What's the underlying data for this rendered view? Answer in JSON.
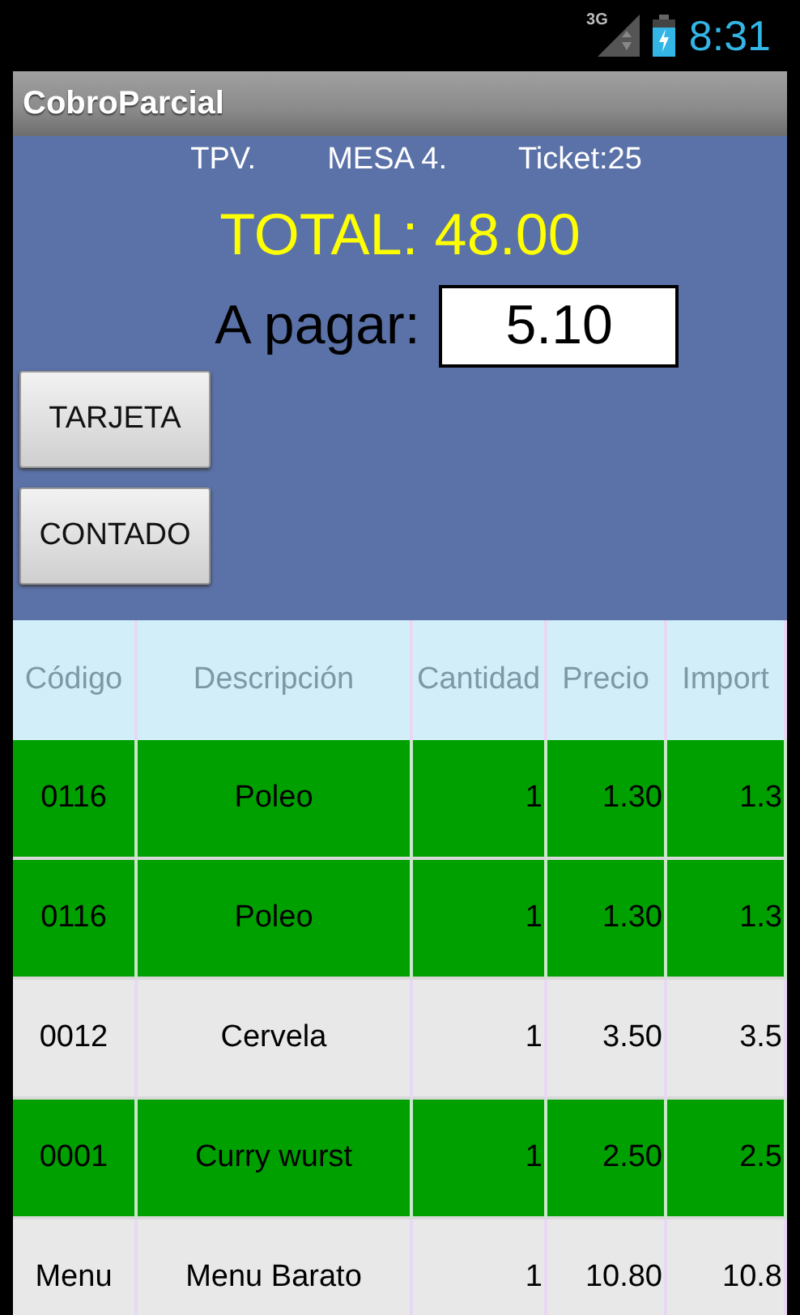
{
  "status_bar": {
    "network": "3G",
    "time": "8:31"
  },
  "title": "CobroParcial",
  "header": {
    "terminal": "TPV.",
    "table": "MESA 4.",
    "ticket": "Ticket:25"
  },
  "total": "TOTAL: 48.00",
  "payment": {
    "label": "A pagar:",
    "value": "5.10"
  },
  "buttons": [
    "TARJETA",
    "CONTADO"
  ],
  "table": {
    "columns": [
      "Código",
      "Descripción",
      "Cantidad",
      "Precio",
      "Import"
    ],
    "rows": [
      {
        "cells": [
          "0116",
          "Poleo",
          "1",
          "1.30",
          "1.3"
        ],
        "selected": true
      },
      {
        "cells": [
          "0116",
          "Poleo",
          "1",
          "1.30",
          "1.3"
        ],
        "selected": true
      },
      {
        "cells": [
          "0012",
          "Cervela",
          "1",
          "3.50",
          "3.5"
        ],
        "selected": false
      },
      {
        "cells": [
          "0001",
          "Curry wurst",
          "1",
          "2.50",
          "2.5"
        ],
        "selected": true
      },
      {
        "cells": [
          "Menu",
          "Menu Barato",
          "1",
          "10.80",
          "10.8"
        ],
        "selected": false
      }
    ]
  }
}
